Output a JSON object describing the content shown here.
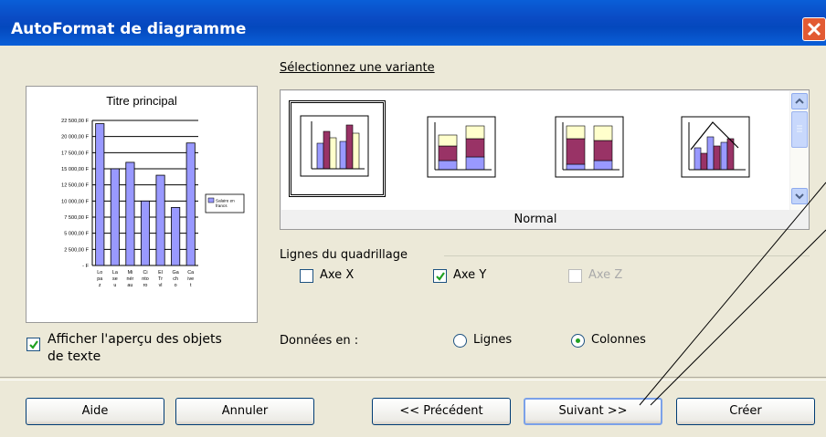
{
  "window": {
    "title": "AutoFormat de diagramme",
    "close_icon": "close-icon"
  },
  "preview": {
    "title": "Titre principal",
    "show_text_checkbox": {
      "label_line1": "Afficher l'aperçu des objets",
      "label_line2": "de texte",
      "checked": true
    }
  },
  "chart_data": {
    "type": "bar",
    "title": "Titre principal",
    "categories": [
      "Lo pa z",
      "La se u",
      "Mi nér au",
      "Ci nto ro",
      "El Tr vl",
      "Ga ch o",
      "Ca ive t"
    ],
    "series": [
      {
        "name": "Salaire en francs",
        "values": [
          22000,
          15000,
          16000,
          10000,
          14000,
          9000,
          19000
        ],
        "color": "#9999ff"
      }
    ],
    "y_ticks": [
      "22 500,00 F",
      "20 000,00 F",
      "17 500,00 F",
      "15 000,00 F",
      "12 500,00 F",
      "10 000,00 F",
      "7 500,00 F",
      "5 000,00 F",
      "2 500,00 F",
      "- F"
    ],
    "ylim": [
      0,
      22500
    ],
    "grid": true,
    "legend_position": "right"
  },
  "variants": {
    "label": "Sélectionnez une variante",
    "selected_name": "Normal",
    "items": [
      "Normal",
      "Empilé",
      "Pourcentage",
      "Lignes et colonnes"
    ],
    "selected_index": 0
  },
  "grid_lines": {
    "label": "Lignes du quadrillage",
    "axis_x": {
      "label": "Axe X",
      "checked": false,
      "enabled": true
    },
    "axis_y": {
      "label": "Axe Y",
      "checked": true,
      "enabled": true
    },
    "axis_z": {
      "label": "Axe Z",
      "checked": false,
      "enabled": false
    }
  },
  "data_in": {
    "label": "Données en :",
    "rows_label": "Lignes",
    "columns_label": "Colonnes",
    "selected": "Colonnes"
  },
  "buttons": {
    "help": "Aide",
    "cancel": "Annuler",
    "previous": "<< Précédent",
    "next": "Suivant >>",
    "create": "Créer"
  },
  "colors": {
    "titlebar": "#0a4bc4",
    "bar": "#9999ff",
    "bar_dark": "#993366",
    "bar_light": "#ffffcc"
  }
}
